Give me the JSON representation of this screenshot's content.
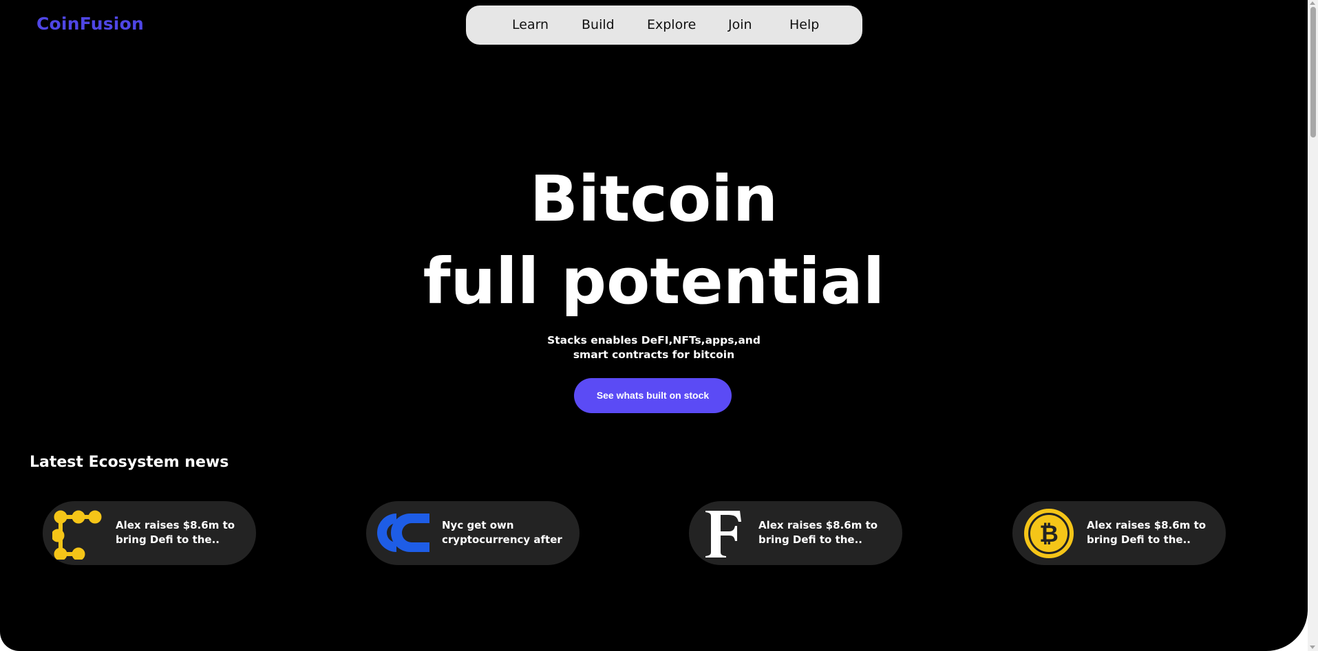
{
  "brand": {
    "name": "CoinFusion",
    "color": "#4f46e5"
  },
  "nav": {
    "items": [
      {
        "label": "Learn"
      },
      {
        "label": "Build"
      },
      {
        "label": "Explore"
      },
      {
        "label": "Join"
      },
      {
        "label": "Help"
      }
    ]
  },
  "hero": {
    "title_line1": "Bitcoin",
    "title_line2": "full potential",
    "subtitle_line1": "Stacks enables DeFI,NFTs,apps,and",
    "subtitle_line2": "smart contracts for bitcoin",
    "cta_label": "See whats built on stock",
    "cta_color": "#5b4bf5"
  },
  "news": {
    "heading": "Latest Ecosystem news",
    "cards": [
      {
        "icon": "alex-logo-icon",
        "icon_color": "#f5c518",
        "text": "Alex raises $8.6m to\nbring Defi to the.."
      },
      {
        "icon": "nyccoin-logo-icon",
        "icon_color": "#1e5de6",
        "text": "Nyc get own\ncryptocurrency after"
      },
      {
        "icon": "forbes-f-icon",
        "icon_color": "#ffffff",
        "text": "Alex raises $8.6m to\nbring Defi to the.."
      },
      {
        "icon": "bitcoin-icon",
        "icon_color": "#f5c518",
        "text": "Alex raises $8.6m to\nbring Defi to the.."
      }
    ]
  }
}
